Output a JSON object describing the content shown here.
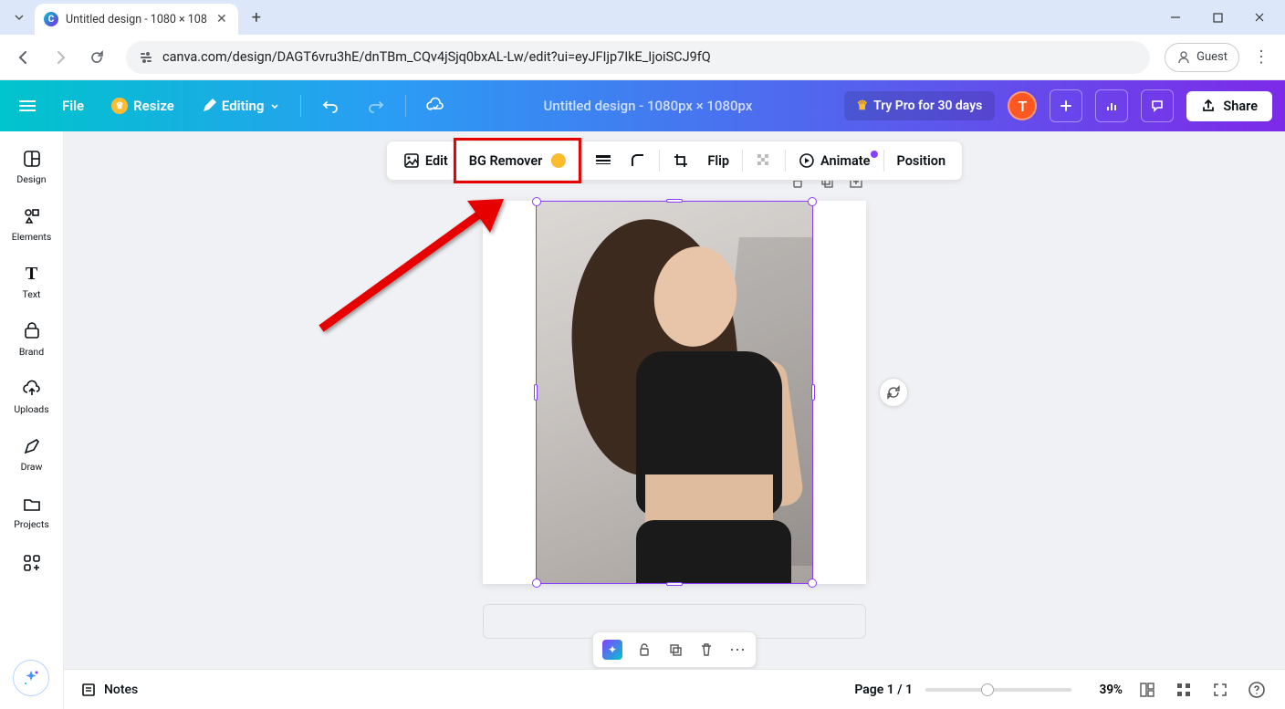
{
  "browser": {
    "tab_title": "Untitled design - 1080 × 108",
    "url": "canva.com/design/DAGT6vru3hE/dnTBm_CQv4jSjq0bxAL-Lw/edit?ui=eyJFIjp7IkE_IjoiSCJ9fQ",
    "guest_label": "Guest"
  },
  "topbar": {
    "file": "File",
    "resize": "Resize",
    "editing": "Editing",
    "design_title": "Untitled design - 1080px × 1080px",
    "try_pro": "Try Pro for 30 days",
    "avatar_letter": "T",
    "share": "Share"
  },
  "rail": {
    "design": "Design",
    "elements": "Elements",
    "text": "Text",
    "brand": "Brand",
    "uploads": "Uploads",
    "draw": "Draw",
    "projects": "Projects"
  },
  "context": {
    "edit": "Edit",
    "bg_remover": "BG Remover",
    "flip": "Flip",
    "animate": "Animate",
    "position": "Position"
  },
  "bottom": {
    "notes": "Notes",
    "page": "Page 1 / 1",
    "zoom": "39%"
  }
}
